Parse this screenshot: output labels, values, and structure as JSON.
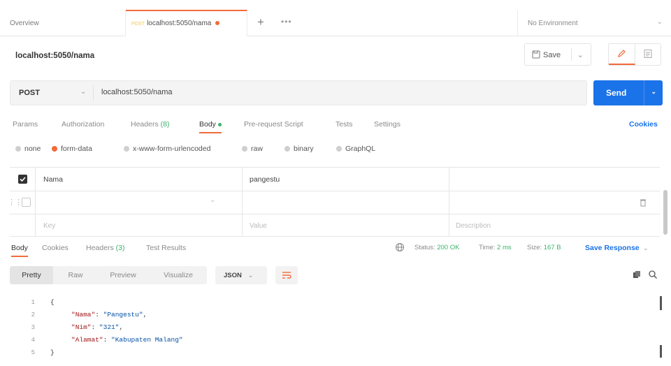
{
  "tabs": {
    "overview": "Overview",
    "active_method": "POST",
    "active_title": "localhost:5050/nama",
    "new_tab": "+",
    "more": "•••",
    "environment": "No Environment"
  },
  "request": {
    "title": "localhost:5050/nama",
    "save_label": "Save",
    "method": "POST",
    "url": "localhost:5050/nama",
    "send_label": "Send"
  },
  "request_tabs": {
    "params": "Params",
    "authorization": "Authorization",
    "headers": "Headers",
    "headers_count": "(8)",
    "body": "Body",
    "pre_request": "Pre-request Script",
    "tests": "Tests",
    "settings": "Settings",
    "cookies": "Cookies"
  },
  "body_types": {
    "none": "none",
    "form_data": "form-data",
    "urlencoded": "x-www-form-urlencoded",
    "raw": "raw",
    "binary": "binary",
    "graphql": "GraphQL",
    "selected": "form-data"
  },
  "form_table": {
    "rows": [
      {
        "checked": true,
        "key": "Nama",
        "value": "pangestu",
        "description": ""
      }
    ],
    "placeholders": {
      "key": "Key",
      "value": "Value",
      "description": "Description"
    }
  },
  "response_tabs": {
    "body": "Body",
    "cookies": "Cookies",
    "headers": "Headers",
    "headers_count": "(3)",
    "test_results": "Test Results"
  },
  "response_status": {
    "status_label": "Status:",
    "status_value": "200 OK",
    "time_label": "Time:",
    "time_value": "2 ms",
    "size_label": "Size:",
    "size_value": "167 B",
    "save_response": "Save Response"
  },
  "viewer": {
    "modes": [
      "Pretty",
      "Raw",
      "Preview",
      "Visualize"
    ],
    "active_mode": "Pretty",
    "format": "JSON"
  },
  "response_body": {
    "line_numbers": [
      "1",
      "2",
      "3",
      "4",
      "5"
    ],
    "open_brace": "{",
    "close_brace": "}",
    "fields": [
      {
        "key": "\"Nama\"",
        "value": "\"Pangestu\"",
        "suffix": ","
      },
      {
        "key": "\"Nim\"",
        "value": "\"321\"",
        "suffix": ","
      },
      {
        "key": "\"Alamat\"",
        "value": "\"Kabupaten Malang\"",
        "suffix": ""
      }
    ]
  },
  "colors": {
    "accent": "#f26b3a",
    "primary": "#1a73e8",
    "success": "#39b36a"
  }
}
